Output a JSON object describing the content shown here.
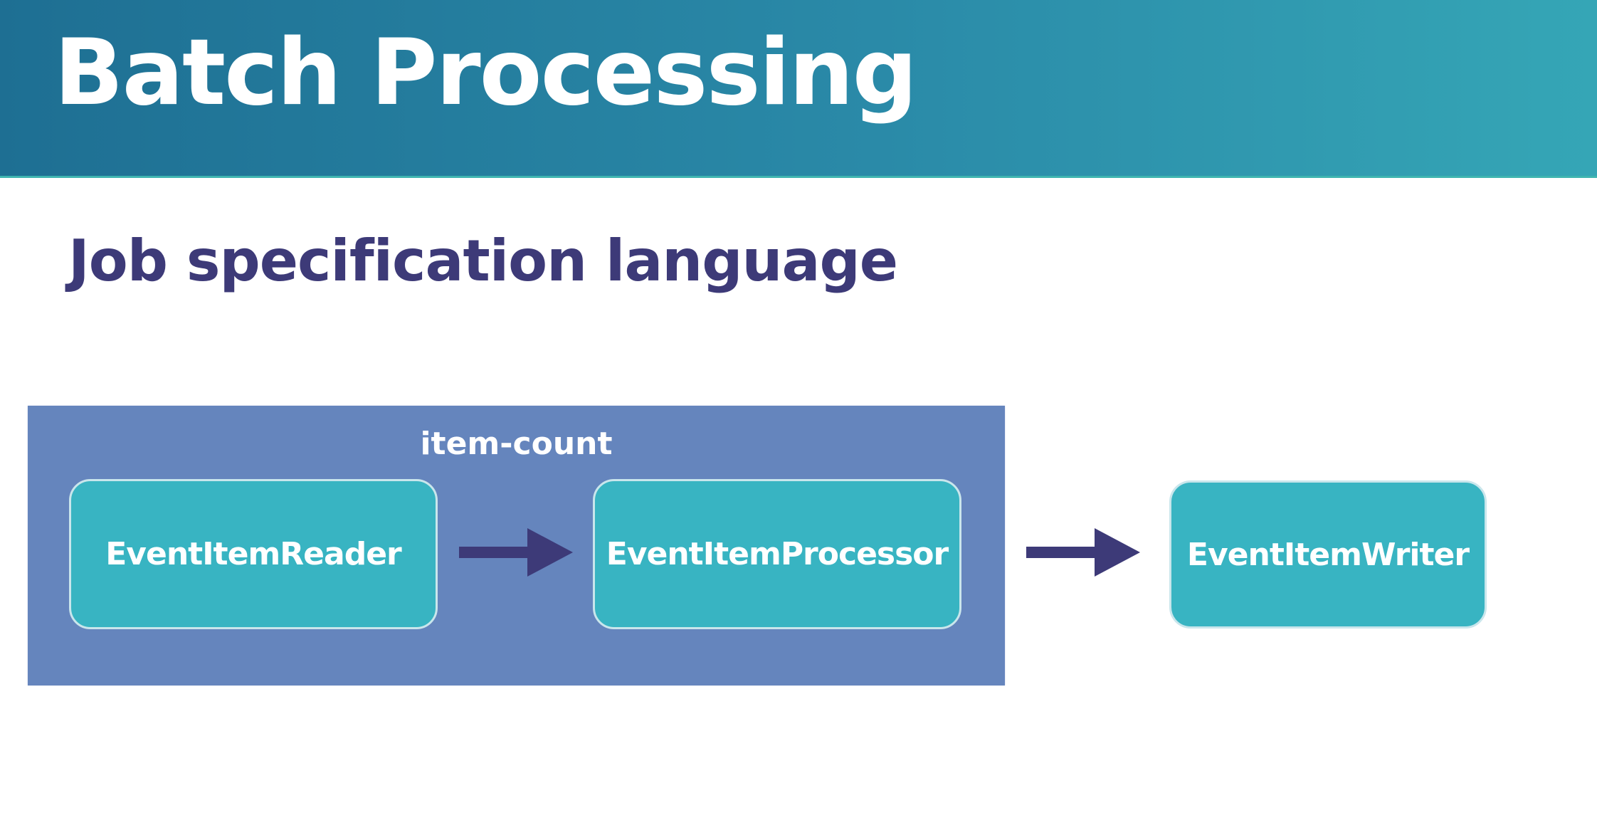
{
  "slide": {
    "title": "Batch Processing",
    "subtitle": "Job specification language"
  },
  "diagram": {
    "group_label": "item-count",
    "nodes": [
      {
        "label": "EventItemReader"
      },
      {
        "label": "EventItemProcessor"
      },
      {
        "label": "EventItemWriter"
      }
    ],
    "colors": {
      "header": "#2a8aa8",
      "group": "#6585bd",
      "node": "#38b4c2",
      "arrow": "#3d3a78",
      "subtitle": "#3d3a78"
    }
  }
}
